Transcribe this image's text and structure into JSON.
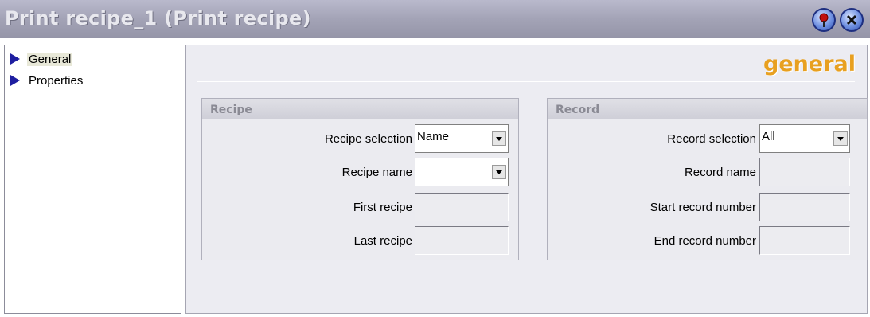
{
  "window": {
    "title": "Print recipe_1 (Print recipe)",
    "pin_icon": "pin-icon",
    "close_icon": "close-icon"
  },
  "nav": {
    "items": [
      {
        "label": "General",
        "selected": true,
        "icon": "arrow-right-icon"
      },
      {
        "label": "Properties",
        "selected": false,
        "icon": "arrow-right-icon"
      }
    ]
  },
  "section": {
    "title": "general"
  },
  "recipe_group": {
    "title": "Recipe",
    "recipe_selection_label": "Recipe selection",
    "recipe_selection_value": "Name",
    "recipe_name_label": "Recipe name",
    "recipe_name_value": "",
    "first_recipe_label": "First recipe",
    "first_recipe_value": "",
    "last_recipe_label": "Last recipe",
    "last_recipe_value": ""
  },
  "record_group": {
    "title": "Record",
    "record_selection_label": "Record selection",
    "record_selection_value": "All",
    "record_name_label": "Record name",
    "record_name_value": "",
    "start_record_number_label": "Start record number",
    "start_record_number_value": "",
    "end_record_number_label": "End record number",
    "end_record_number_value": ""
  },
  "colors": {
    "title_bar": "#a3a3b6",
    "section_title": "#e8a020",
    "nav_arrow": "#1e1ea0"
  }
}
